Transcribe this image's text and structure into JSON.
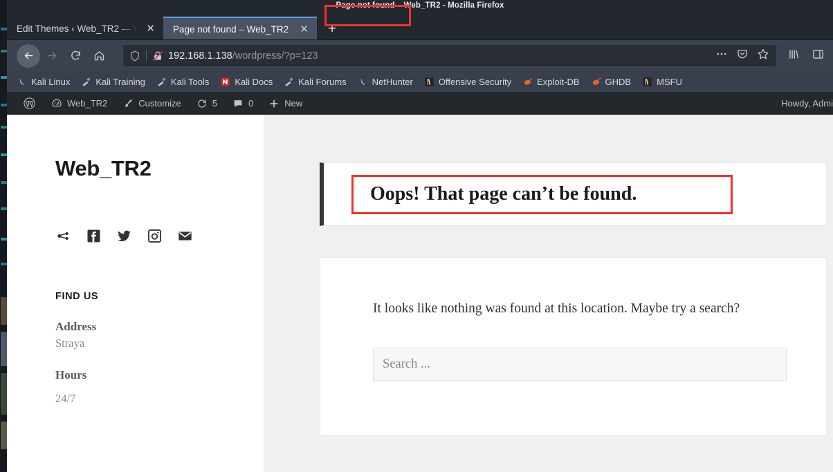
{
  "window": {
    "title": "Page not found – Web_TR2 - Mozilla Firefox"
  },
  "tabs": [
    {
      "label": "Edit Themes ‹ Web_TR2 — \\",
      "close": "✕",
      "active": false
    },
    {
      "label": "Page not found – Web_TR2",
      "close": "✕",
      "active": true
    }
  ],
  "newtab_label": "+",
  "urlbar": {
    "host": "192.168.1.138",
    "path": "/wordpress/",
    "query": "?p=123",
    "full": "192.168.1.138/wordpress/?p=123",
    "highlight_color": "#f0312f",
    "icons": {
      "shield": "shield-icon",
      "lock": "lock-crossed-icon",
      "more": "ellipsis-icon",
      "pocket": "pocket-icon",
      "bookmark": "star-icon"
    }
  },
  "toolbar_icons": {
    "library": "library-icon",
    "sidebar": "sidebar-icon"
  },
  "bookmarks": [
    {
      "label": "Kali Linux",
      "icon": "kali-dragon-icon"
    },
    {
      "label": "Kali Training",
      "icon": "kali-tool-icon"
    },
    {
      "label": "Kali Tools",
      "icon": "kali-tool-icon"
    },
    {
      "label": "Kali Docs",
      "icon": "kali-docs-icon"
    },
    {
      "label": "Kali Forums",
      "icon": "kali-tool-icon"
    },
    {
      "label": "NetHunter",
      "icon": "kali-dragon-icon"
    },
    {
      "label": "Offensive Security",
      "icon": "offsec-icon"
    },
    {
      "label": "Exploit-DB",
      "icon": "exploitdb-icon"
    },
    {
      "label": "GHDB",
      "icon": "exploitdb-icon"
    },
    {
      "label": "MSFU",
      "icon": "offsec-icon"
    }
  ],
  "wpadminbar": {
    "logo": "wordpress-logo-icon",
    "items": [
      {
        "label": "Web_TR2",
        "icon": "dashboard-icon"
      },
      {
        "label": "Customize",
        "icon": "brush-icon"
      },
      {
        "label": "5",
        "icon": "updates-icon"
      },
      {
        "label": "0",
        "icon": "comments-icon"
      },
      {
        "label": "New",
        "icon": "plus-icon"
      }
    ],
    "howdy": "Howdy, Admi"
  },
  "site": {
    "title": "Web_TR2",
    "social": [
      {
        "icon": "link-share-icon"
      },
      {
        "icon": "facebook-icon"
      },
      {
        "icon": "twitter-icon"
      },
      {
        "icon": "instagram-icon"
      },
      {
        "icon": "email-icon"
      }
    ],
    "widget": {
      "heading": "FIND US",
      "address_label": "Address",
      "address_value": "Straya",
      "hours_label": "Hours",
      "hours_value": "24/7"
    }
  },
  "main": {
    "page_title": "Oops! That page can’t be found.",
    "body_text": "It looks like nothing was found at this location. Maybe try a search?",
    "search_placeholder": "Search ...",
    "search_value": ""
  }
}
